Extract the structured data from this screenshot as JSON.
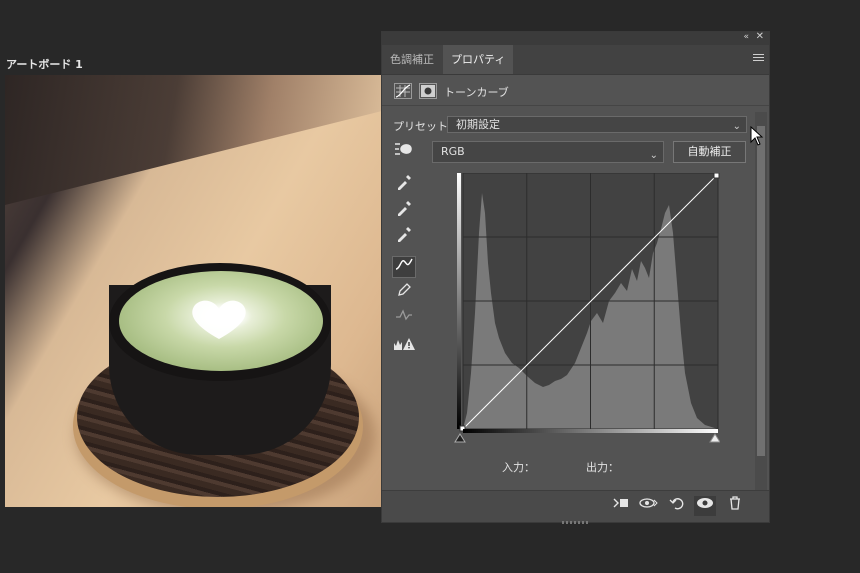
{
  "artboard": {
    "label": "アートボード 1"
  },
  "panel": {
    "tabs": [
      {
        "label": "色調補正"
      },
      {
        "label": "プロパティ"
      }
    ],
    "header_title": "トーンカーブ",
    "preset_label": "プリセット：",
    "preset_value": "初期設定",
    "channel_value": "RGB",
    "auto_button": "自動補正",
    "input_label": "入力：",
    "output_label": "出力："
  },
  "icons": {
    "collapse": "«",
    "close": "✕",
    "tools": [
      "target-adjust-icon",
      "black-eyedropper-icon",
      "gray-eyedropper-icon",
      "white-eyedropper-icon",
      "curve-points-icon",
      "pencil-icon",
      "smooth-curve-icon",
      "clipping-warning-icon"
    ],
    "bottom": [
      "clip-to-layer-icon",
      "view-previous-icon",
      "reset-icon",
      "visibility-eye-icon",
      "trash-icon"
    ]
  }
}
